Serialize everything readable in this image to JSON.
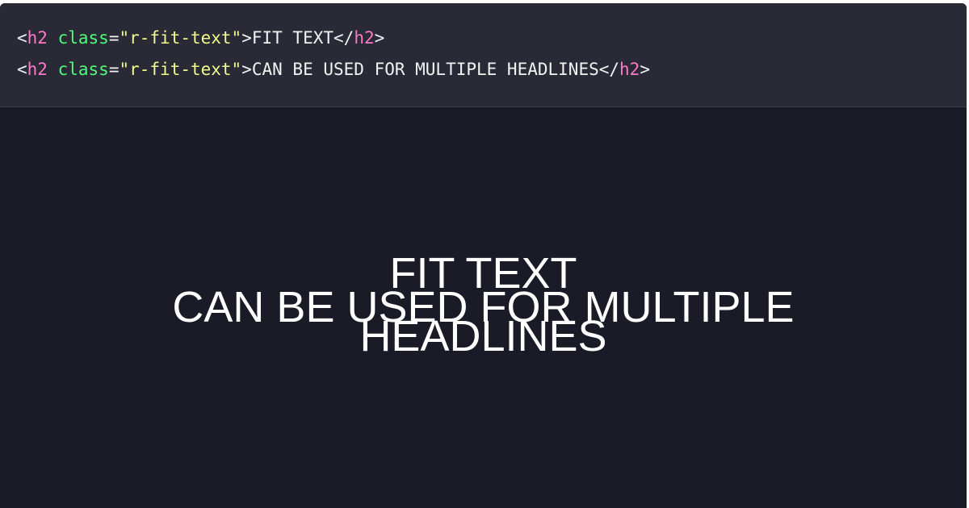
{
  "code": {
    "line1": {
      "open_lt": "<",
      "open_tag": "h2",
      "space": " ",
      "attr_name": "class",
      "equals": "=",
      "attr_value": "\"r-fit-text\"",
      "open_gt": ">",
      "text": "FIT TEXT",
      "close_lt": "</",
      "close_tag": "h2",
      "close_gt": ">"
    },
    "line2": {
      "open_lt": "<",
      "open_tag": "h2",
      "space": " ",
      "attr_name": "class",
      "equals": "=",
      "attr_value": "\"r-fit-text\"",
      "open_gt": ">",
      "text": "CAN BE USED FOR MULTIPLE HEADLINES",
      "close_lt": "</",
      "close_tag": "h2",
      "close_gt": ">"
    }
  },
  "preview": {
    "headline1": "FIT TEXT",
    "headline2_line1": "CAN BE USED FOR MULTIPLE",
    "headline2_line2": "HEADLINES"
  },
  "colors": {
    "code_background": "#292a36",
    "preview_background": "#1b1a27",
    "tag": "#ff79c6",
    "attribute": "#50fa7b",
    "string": "#f1fa8c",
    "text": "#f2f2f2"
  }
}
